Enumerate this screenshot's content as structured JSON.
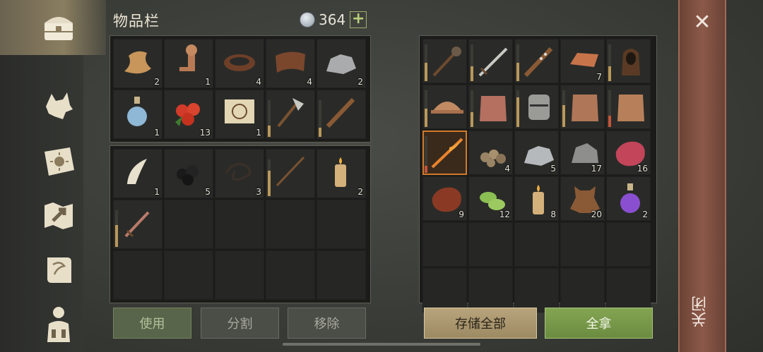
{
  "header": {
    "title": "物品栏",
    "coins": "364",
    "add_icon": "+"
  },
  "inventory": {
    "top_grid": [
      {
        "name": "cloth-icon",
        "count": "2"
      },
      {
        "name": "key-icon",
        "count": "1"
      },
      {
        "name": "leather-strap-icon",
        "count": "4"
      },
      {
        "name": "leather-icon",
        "count": "4"
      },
      {
        "name": "stone-icon",
        "count": "2"
      },
      {
        "name": "potion-bottle-icon",
        "count": "1"
      },
      {
        "name": "berries-icon",
        "count": "13"
      },
      {
        "name": "recipe-scroll-icon",
        "count": "1"
      },
      {
        "name": "hatchet-icon",
        "count": "",
        "durability": 0.3
      },
      {
        "name": "club-icon",
        "count": "",
        "durability": 0.25
      }
    ],
    "bottom_grid": [
      {
        "name": "fang-icon",
        "count": "1"
      },
      {
        "name": "coal-icon",
        "count": "5"
      },
      {
        "name": "rope-icon",
        "count": "3"
      },
      {
        "name": "spear-icon",
        "count": "",
        "durability": 0.7
      },
      {
        "name": "candle-icon",
        "count": "2"
      },
      {
        "name": "dagger-icon",
        "count": "",
        "durability": 0.6
      },
      {
        "name": "",
        "count": ""
      },
      {
        "name": "",
        "count": ""
      },
      {
        "name": "",
        "count": ""
      },
      {
        "name": "",
        "count": ""
      },
      {
        "name": "",
        "count": ""
      },
      {
        "name": "",
        "count": ""
      },
      {
        "name": "",
        "count": ""
      },
      {
        "name": "",
        "count": ""
      },
      {
        "name": "",
        "count": ""
      }
    ]
  },
  "storage": {
    "grid": [
      {
        "name": "mace-icon",
        "count": "",
        "durability": 0.5
      },
      {
        "name": "sword-icon",
        "count": "",
        "durability": 0.4
      },
      {
        "name": "spiked-club-icon",
        "count": "",
        "durability": 0.5
      },
      {
        "name": "copper-ingot-icon",
        "count": "7"
      },
      {
        "name": "hood-icon",
        "count": "",
        "durability": 0.4
      },
      {
        "name": "helmet-icon",
        "count": "",
        "durability": 0.5
      },
      {
        "name": "chainmail-icon",
        "count": "",
        "durability": 0.4
      },
      {
        "name": "great-helm-icon",
        "count": "",
        "durability": 0.8
      },
      {
        "name": "chain-shirt-icon",
        "count": "",
        "durability": 0.6
      },
      {
        "name": "chain-armor-icon",
        "count": "",
        "durability": 0.3,
        "low": true
      },
      {
        "name": "flaming-arrow-icon",
        "count": "",
        "selected": true,
        "durability": 0.2,
        "low": true
      },
      {
        "name": "ore-pile-icon",
        "count": "4"
      },
      {
        "name": "iron-ore-icon",
        "count": "5"
      },
      {
        "name": "rock-icon",
        "count": "17"
      },
      {
        "name": "raw-meat-icon",
        "count": "16"
      },
      {
        "name": "steak-icon",
        "count": "9"
      },
      {
        "name": "cactus-slices-icon",
        "count": "12"
      },
      {
        "name": "candle-icon",
        "count": "8"
      },
      {
        "name": "hide-icon",
        "count": "20"
      },
      {
        "name": "purple-potion-icon",
        "count": "2"
      },
      {
        "name": "",
        "count": ""
      },
      {
        "name": "",
        "count": ""
      },
      {
        "name": "",
        "count": ""
      },
      {
        "name": "",
        "count": ""
      },
      {
        "name": "",
        "count": ""
      },
      {
        "name": "",
        "count": ""
      },
      {
        "name": "",
        "count": ""
      },
      {
        "name": "",
        "count": ""
      },
      {
        "name": "",
        "count": ""
      },
      {
        "name": "",
        "count": ""
      }
    ]
  },
  "buttons": {
    "use": "使用",
    "split": "分割",
    "remove": "移除",
    "store_all": "存储全部",
    "take_all": "全拿"
  },
  "close": {
    "x": "✕",
    "label": "关闭"
  }
}
